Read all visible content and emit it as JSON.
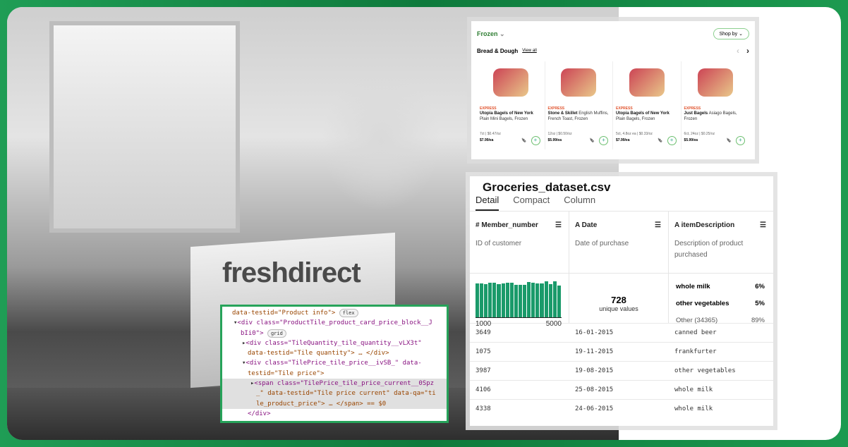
{
  "photo": {
    "brand": "freshdirect"
  },
  "product_panel": {
    "category": "Frozen",
    "shop_by": "Shop by",
    "section": "Bread & Dough",
    "view_all": "View all",
    "products": [
      {
        "badge": "EXPRESS",
        "brand": "Utopia Bagels of New York",
        "name": "Plain Mini Bagels, Frozen",
        "meta": "7ct | $0.47/oz",
        "price": "$7.99/ea"
      },
      {
        "badge": "EXPRESS",
        "brand": "Stone & Skillet",
        "name": "English Muffins, French Toast, Frozen",
        "meta": "12oz | $0.50/oz",
        "price": "$5.99/ea"
      },
      {
        "badge": "EXPRESS",
        "brand": "Utopia Bagels of New York",
        "name": "Plain Bagels, Frozen",
        "meta": "5ct, 4.8oz ea | $0.33/oz",
        "price": "$7.99/ea"
      },
      {
        "badge": "EXPRESS",
        "brand": "Just Bagels",
        "name": "Asiago Bagels, Frozen",
        "meta": "6ct, 24oz | $0.25/oz",
        "price": "$5.99/ea"
      }
    ]
  },
  "code": {
    "l1": "data-testid=\"Product info\">",
    "l1b": "flex",
    "l2": "<div class=\"ProductTile_product_card_price_block__J",
    "l3": "bIi0\">",
    "l3b": "grid",
    "l4": "<div class=\"TileQuantity_tile_quantity__vLX3t\"",
    "l5": "data-testid=\"Tile quantity\"> … </div>",
    "l6": "<div class=\"TilePrice_tile_price__ivSB_\" data-",
    "l7": "testid=\"Tile price\">",
    "l8": "<span class=\"TilePrice_tile_price_current__0Spz",
    "l9": "_\" data-testid=\"Tile price current\" data-qa=\"ti",
    "l10": "le_product_price\"> … </span> == $0",
    "l11": "</div>"
  },
  "dataset": {
    "title": "Groceries_dataset.csv",
    "tabs": [
      "Detail",
      "Compact",
      "Column"
    ],
    "columns": [
      {
        "name": "Member_number",
        "icon": "#",
        "desc": "ID of customer"
      },
      {
        "name": "Date",
        "icon": "A",
        "desc": "Date of purchase"
      },
      {
        "name": "itemDescription",
        "icon": "A",
        "desc": "Description of product purchased"
      }
    ],
    "histogram": {
      "min": "1000",
      "max": "5000",
      "relative_heights": [
        88,
        89,
        87,
        90,
        90,
        87,
        89,
        91,
        90,
        85,
        86,
        85,
        92,
        90,
        88,
        88,
        94,
        87,
        95,
        83
      ]
    },
    "date_unique": "728",
    "date_unique_label": "unique values",
    "top_items": [
      {
        "label": "whole milk",
        "pct": "6%"
      },
      {
        "label": "other vegetables",
        "pct": "5%"
      },
      {
        "label": "Other (34365)",
        "pct": "89%"
      }
    ],
    "rows": [
      [
        "3649",
        "16-01-2015",
        "canned beer"
      ],
      [
        "1075",
        "19-11-2015",
        "frankfurter"
      ],
      [
        "3987",
        "19-08-2015",
        "other vegetables"
      ],
      [
        "4106",
        "25-08-2015",
        "whole milk"
      ],
      [
        "4338",
        "24-06-2015",
        "whole milk"
      ]
    ]
  },
  "colors": {
    "accent_green": "#1a9a6a",
    "frame_green": "#0e7a3c"
  }
}
